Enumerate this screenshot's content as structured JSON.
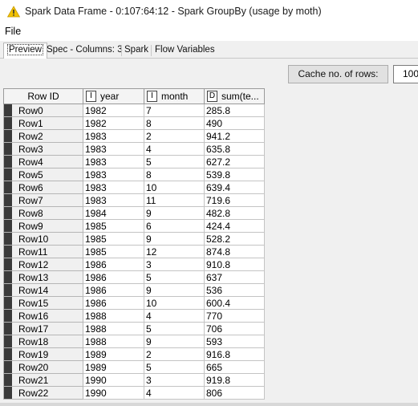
{
  "window": {
    "title": "Spark Data Frame - 0:107:64:12 - Spark GroupBy (usage by moth)",
    "icon": "warning-triangle-icon",
    "icon_color": "#f2c200"
  },
  "menu": {
    "file": "File"
  },
  "tabs": [
    {
      "label": "Preview",
      "active": true
    },
    {
      "label": "Spec - Columns: 3",
      "active": false
    },
    {
      "label": "Spark",
      "active": false
    },
    {
      "label": "Flow Variables",
      "active": false
    }
  ],
  "toolbar": {
    "cache_button": "Cache no. of rows:",
    "cache_value": "100"
  },
  "table": {
    "columns": [
      {
        "label": "Row ID",
        "type": ""
      },
      {
        "label": "year",
        "type": "I"
      },
      {
        "label": "month",
        "type": "I"
      },
      {
        "label": "sum(te...",
        "type": "D"
      }
    ],
    "rows": [
      [
        "Row0",
        "1982",
        "7",
        "285.8"
      ],
      [
        "Row1",
        "1982",
        "8",
        "490"
      ],
      [
        "Row2",
        "1983",
        "2",
        "941.2"
      ],
      [
        "Row3",
        "1983",
        "4",
        "635.8"
      ],
      [
        "Row4",
        "1983",
        "5",
        "627.2"
      ],
      [
        "Row5",
        "1983",
        "8",
        "539.8"
      ],
      [
        "Row6",
        "1983",
        "10",
        "639.4"
      ],
      [
        "Row7",
        "1983",
        "11",
        "719.6"
      ],
      [
        "Row8",
        "1984",
        "9",
        "482.8"
      ],
      [
        "Row9",
        "1985",
        "6",
        "424.4"
      ],
      [
        "Row10",
        "1985",
        "9",
        "528.2"
      ],
      [
        "Row11",
        "1985",
        "12",
        "874.8"
      ],
      [
        "Row12",
        "1986",
        "3",
        "910.8"
      ],
      [
        "Row13",
        "1986",
        "5",
        "637"
      ],
      [
        "Row14",
        "1986",
        "9",
        "536"
      ],
      [
        "Row15",
        "1986",
        "10",
        "600.4"
      ],
      [
        "Row16",
        "1988",
        "4",
        "770"
      ],
      [
        "Row17",
        "1988",
        "5",
        "706"
      ],
      [
        "Row18",
        "1988",
        "9",
        "593"
      ],
      [
        "Row19",
        "1989",
        "2",
        "916.8"
      ],
      [
        "Row20",
        "1989",
        "5",
        "665"
      ],
      [
        "Row21",
        "1990",
        "3",
        "919.8"
      ],
      [
        "Row22",
        "1990",
        "4",
        "806"
      ]
    ]
  }
}
